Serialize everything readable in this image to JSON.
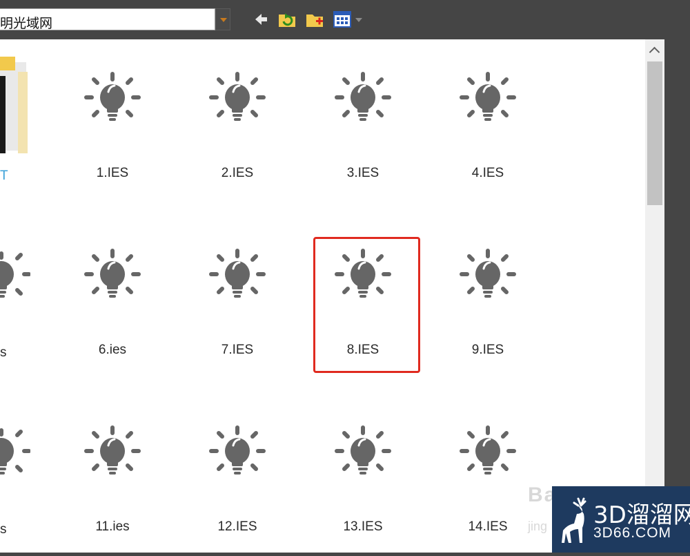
{
  "toolbar": {
    "path_value": "明光域网",
    "icons": [
      "back-arrow-icon",
      "refresh-folder-icon",
      "new-folder-icon",
      "view-options-icon"
    ]
  },
  "partial_labels": [
    "T",
    "s",
    "s"
  ],
  "items": [
    {
      "label": "1.IES"
    },
    {
      "label": "2.IES"
    },
    {
      "label": "3.IES"
    },
    {
      "label": "4.IES"
    },
    {
      "label": "6.ies"
    },
    {
      "label": "7.IES"
    },
    {
      "label": "8.IES"
    },
    {
      "label": "9.IES"
    },
    {
      "label": "11.ies"
    },
    {
      "label": "12.IES"
    },
    {
      "label": "13.IES"
    },
    {
      "label": "14.IES"
    }
  ],
  "selected_item": "8.IES",
  "watermark": {
    "title": "3D溜溜网",
    "subtitle": "3D66.COM",
    "faded_text": "Ba",
    "faded_sub": "jing"
  },
  "colors": {
    "toolbar_bg": "#454545",
    "bulb_icon": "#666666",
    "selection_outline": "#e02a1f",
    "watermark_bg": "#1e3a5f"
  }
}
